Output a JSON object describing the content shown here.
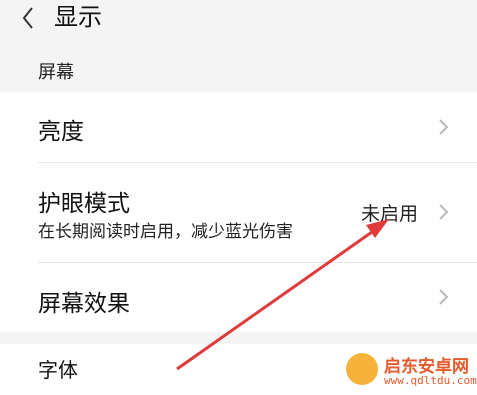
{
  "header": {
    "title": "显示",
    "back_icon": "chevron-left-icon"
  },
  "section": {
    "label": "屏幕"
  },
  "rows": [
    {
      "title": "亮度"
    },
    {
      "title": "护眼模式",
      "subtitle": "在长期阅读时启用，减少蓝光伤害",
      "value": "未启用"
    },
    {
      "title": "屏幕效果"
    }
  ],
  "font_row": {
    "title": "字体"
  },
  "watermark": {
    "name": "启东安卓网",
    "url": "www.qdltdu.com"
  },
  "colors": {
    "arrow": "#e03a3a",
    "background": "#f4f4f4",
    "card": "#ffffff"
  }
}
